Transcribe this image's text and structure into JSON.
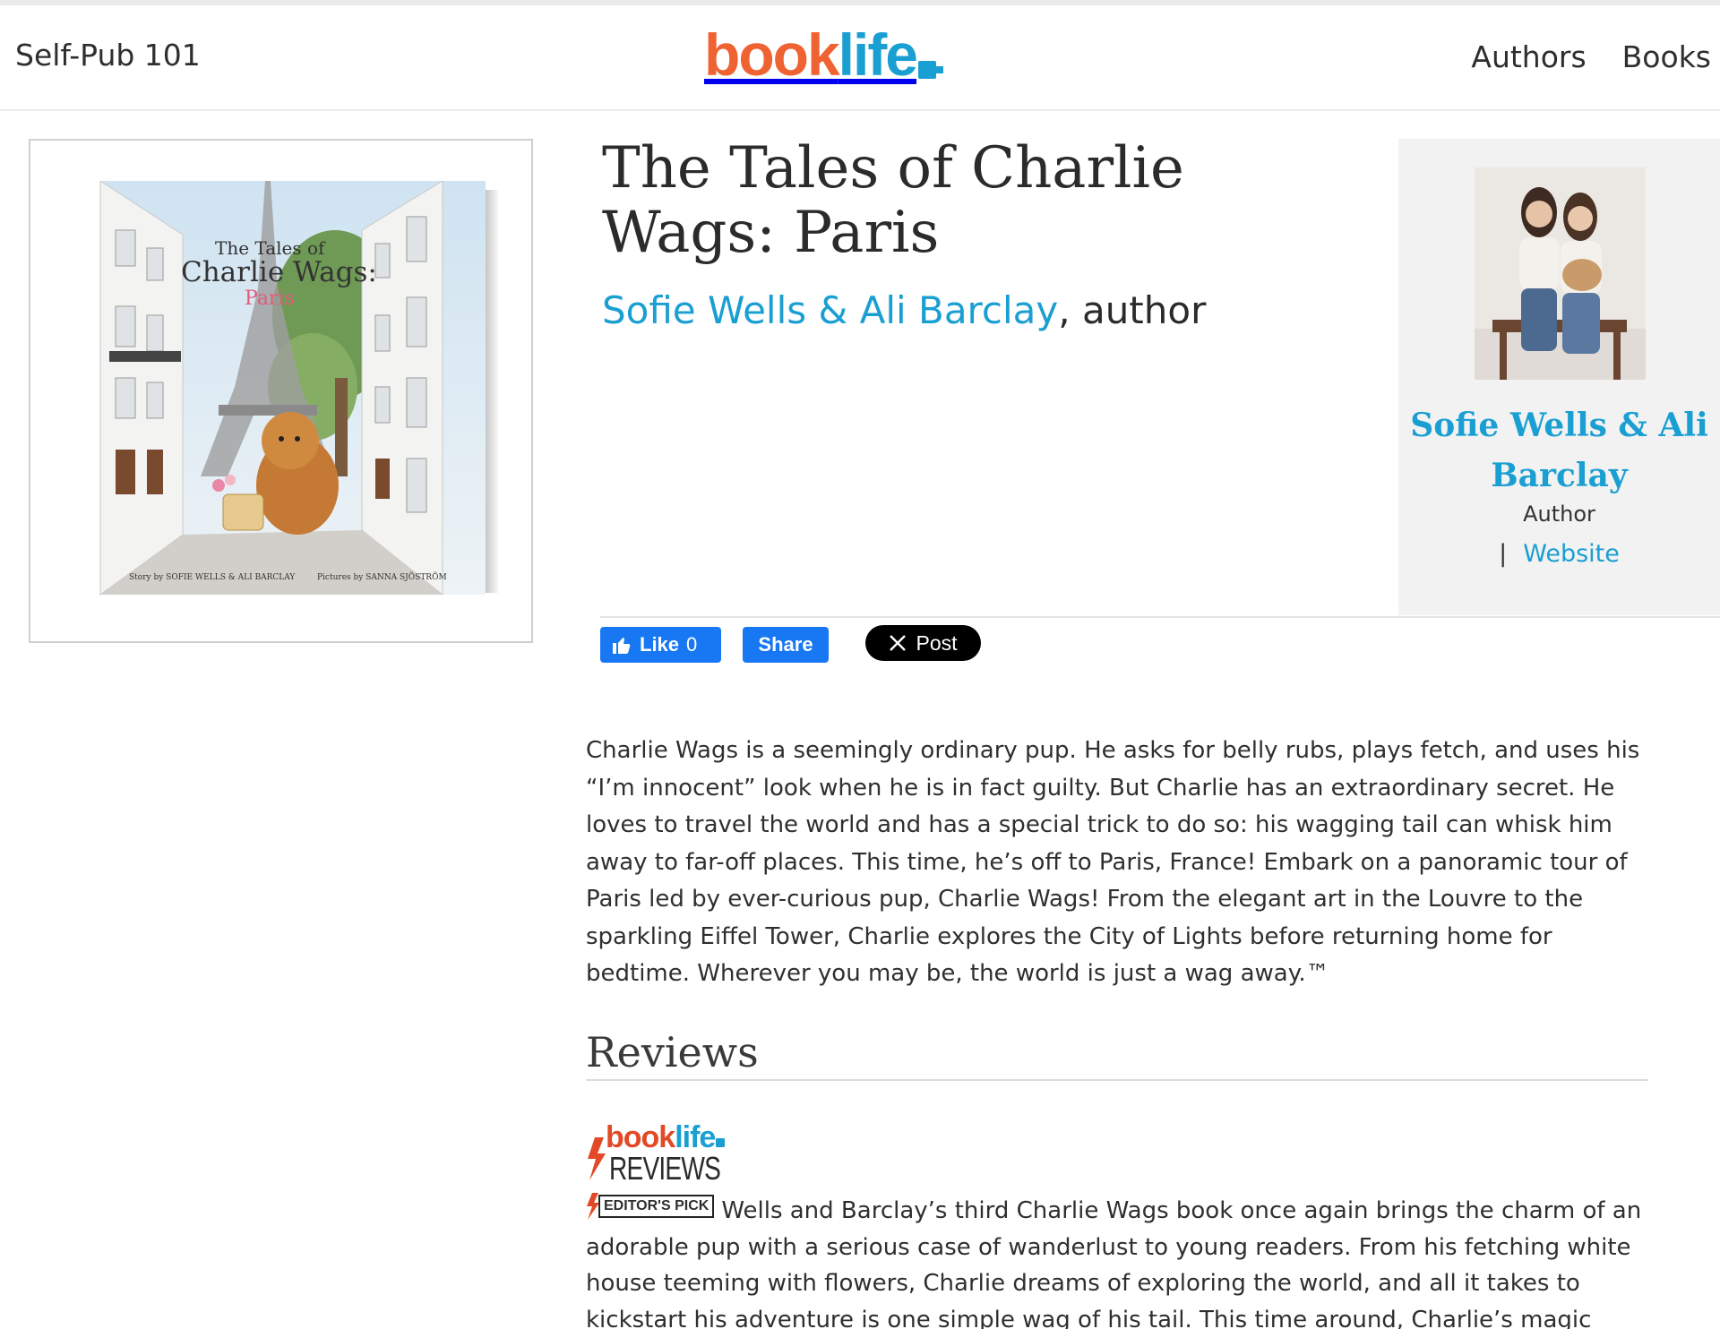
{
  "header": {
    "nav_left": "Self-Pub 101",
    "logo": {
      "book": "book",
      "life": "life"
    },
    "nav_right": [
      "Authors",
      "Books"
    ]
  },
  "cover": {
    "title_line1": "The Tales of",
    "title_line2": "Charlie Wags:",
    "title_line3": "Paris",
    "credit_story": "Story by SOFIE WELLS & ALI BARCLAY",
    "credit_pictures": "Pictures by SANNA SJÖSTRÖM"
  },
  "book": {
    "title": "The Tales of Charlie Wags: Paris",
    "author_link": "Sofie Wells & Ali Barclay",
    "author_suffix": ", author"
  },
  "author_card": {
    "name": "Sofie Wells & Ali Barclay",
    "role": "Author",
    "separator": "|",
    "website_label": "Website"
  },
  "share": {
    "like_label": "Like",
    "like_count": "0",
    "share_label": "Share",
    "post_label": "Post"
  },
  "description": "Charlie Wags is a seemingly ordinary pup. He asks for belly rubs, plays fetch, and uses his “I’m innocent” look when he is in fact guilty. But Charlie has an extraordinary secret. He loves to travel the world and has a special trick to do so: his wagging tail can whisk him away to far-off places. This time, he’s off to Paris, France! Embark on a panoramic tour of Paris led by ever-curious pup, Charlie Wags! From the elegant art in the Louvre to the sparkling Eiffel Tower, Charlie explores the City of Lights before returning home for bedtime. Wherever you may be, the world is just a wag away.™",
  "reviews": {
    "heading": "Reviews",
    "logo_book": "book",
    "logo_life": "life",
    "logo_reviews": "REVIEWS",
    "badge": "EDITOR'S PICK",
    "text": "Wells and Barclay’s third Charlie Wags book once again brings the charm of an adorable pup with a serious case of wanderlust to young readers. From his fetching white house teeming with flowers, Charlie dreams of exploring the world, and all it takes to kickstart his adventure is one simple wag of his tail. This time around, Charlie’s magic sweeps him to the"
  },
  "colors": {
    "brand_orange": "#ef6231",
    "brand_blue": "#1a9fd2",
    "facebook_blue": "#1877f2"
  }
}
